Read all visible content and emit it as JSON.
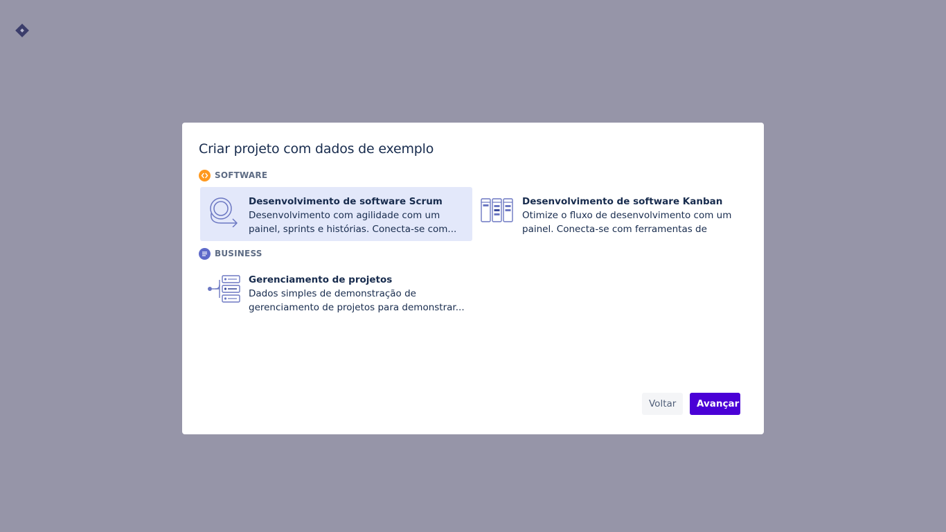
{
  "app": {
    "logo_icon": "jira-diamond-icon"
  },
  "dialog": {
    "title": "Criar projeto com dados de exemplo",
    "sections": [
      {
        "label": "SOFTWARE",
        "icon": "code-brackets-icon",
        "icon_color": "#ff991f",
        "cards": [
          {
            "title": "Desenvolvimento de software Scrum",
            "description": "Desenvolvimento com agilidade com um painel, sprints e histórias. Conecta-se com...",
            "icon": "scrum-cycle-icon",
            "selected": true
          },
          {
            "title": "Desenvolvimento de software Kanban",
            "description": "Otimize o fluxo de desenvolvimento com um painel. Conecta-se com ferramentas de origem...",
            "icon": "kanban-columns-icon",
            "selected": false
          }
        ]
      },
      {
        "label": "BUSINESS",
        "icon": "lines-icon",
        "icon_color": "#5e6ac9",
        "cards": [
          {
            "title": "Gerenciamento de projetos",
            "description": "Dados simples de demonstração de gerenciamento de projetos para demonstrar...",
            "icon": "project-tree-icon",
            "selected": false
          }
        ]
      }
    ],
    "buttons": {
      "back_label": "Voltar",
      "next_label": "Avançar"
    }
  },
  "colors": {
    "backdrop": "#9695a8",
    "selected_card": "#e3e8fa",
    "primary_button": "#4a00d6",
    "text": "#172b4d",
    "illustration": "#6b77c2"
  }
}
